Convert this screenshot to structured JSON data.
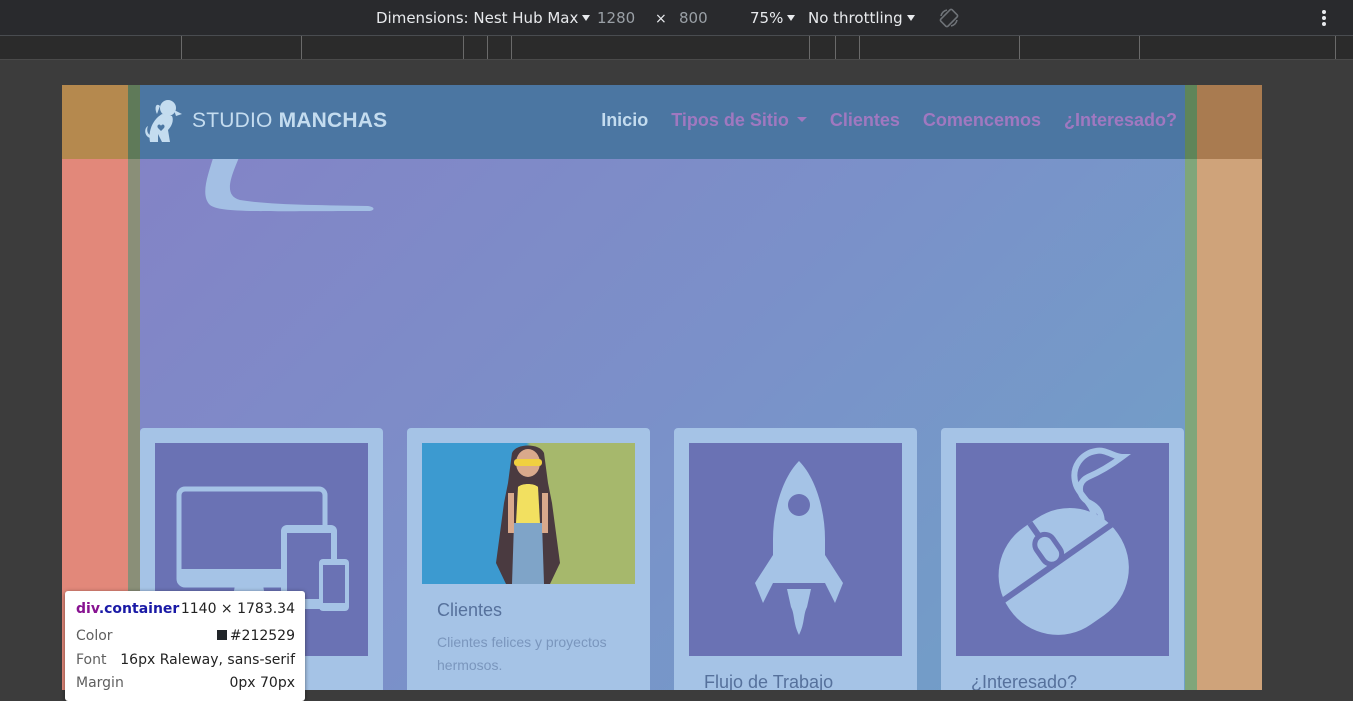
{
  "devtools": {
    "dimensions_label": "Dimensions: Nest Hub Max",
    "width": "1280",
    "times": "×",
    "height": "800",
    "zoom": "75%",
    "throttling": "No throttling",
    "rotate_icon": "rotate-icon",
    "more_icon": "kebab-menu-icon"
  },
  "site": {
    "brand_light": "STUDIO ",
    "brand_bold": "MANCHAS",
    "nav": [
      {
        "label": "Inicio",
        "active": true
      },
      {
        "label": "Tipos de Sitio",
        "dropdown": true
      },
      {
        "label": "Clientes"
      },
      {
        "label": "Comencemos"
      },
      {
        "label": "¿Interesado?"
      }
    ],
    "cards": [
      {
        "icon": "devices-icon",
        "title": "",
        "text": ""
      },
      {
        "icon": "client-photo",
        "title": "Clientes",
        "text": "Clientes felices y proyectos hermosos."
      },
      {
        "icon": "rocket-icon",
        "title": "Flujo de Trabajo",
        "text": ""
      },
      {
        "icon": "mouse-icon",
        "title": "¿Interesado?",
        "text": ""
      }
    ]
  },
  "tooltip": {
    "selector_tag": "div",
    "selector_class": ".container",
    "size": "1140 × 1783.34",
    "color_label": "Color",
    "color_value": "#212529",
    "font_label": "Font",
    "font_value": "16px Raleway, sans-serif",
    "margin_label": "Margin",
    "margin_value": "0px 70px"
  },
  "colors": {
    "margin_overlay": "#e88c7a",
    "padding_overlay": "#7fa67a",
    "content_overlay": "#7b90c9",
    "navbar": "#4b76a2"
  }
}
